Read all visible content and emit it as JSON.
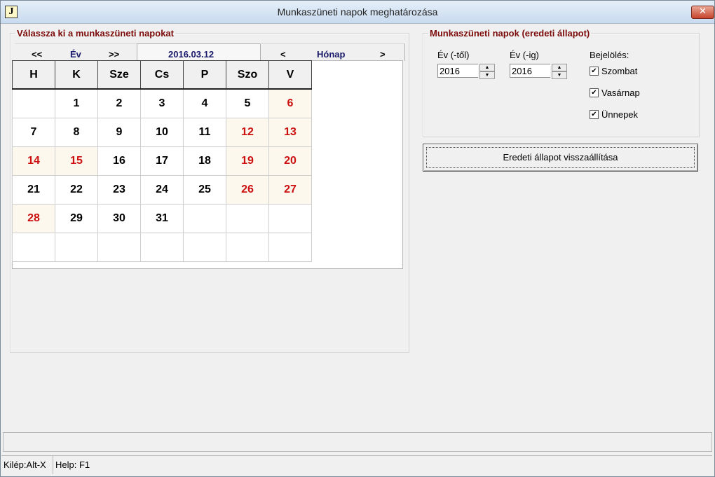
{
  "window": {
    "title": "Munkaszüneti napok meghatározása",
    "icon_letter": "J",
    "close_glyph": "✕"
  },
  "calendar_panel": {
    "legend": "Válassza ki a munkaszüneti napokat",
    "year_nav": {
      "prev": "<<",
      "label": "Év",
      "next": ">>"
    },
    "current_date": "2016.03.12",
    "month_nav": {
      "prev": "<",
      "label": "Hónap",
      "next": ">"
    },
    "weekdays": [
      "H",
      "K",
      "Sze",
      "Cs",
      "P",
      "Szo",
      "V"
    ],
    "weeks": [
      [
        {
          "d": ""
        },
        {
          "d": "1"
        },
        {
          "d": "2"
        },
        {
          "d": "3"
        },
        {
          "d": "4"
        },
        {
          "d": "5"
        },
        {
          "d": "6",
          "hol": true
        }
      ],
      [
        {
          "d": "7"
        },
        {
          "d": "8"
        },
        {
          "d": "9"
        },
        {
          "d": "10"
        },
        {
          "d": "11"
        },
        {
          "d": "12",
          "hol": true
        },
        {
          "d": "13",
          "hol": true
        }
      ],
      [
        {
          "d": "14",
          "hol": true
        },
        {
          "d": "15",
          "hol": true
        },
        {
          "d": "16"
        },
        {
          "d": "17"
        },
        {
          "d": "18"
        },
        {
          "d": "19",
          "hol": true
        },
        {
          "d": "20",
          "hol": true
        }
      ],
      [
        {
          "d": "21"
        },
        {
          "d": "22"
        },
        {
          "d": "23"
        },
        {
          "d": "24"
        },
        {
          "d": "25"
        },
        {
          "d": "26",
          "hol": true
        },
        {
          "d": "27",
          "hol": true
        }
      ],
      [
        {
          "d": "28",
          "hol": true
        },
        {
          "d": "29"
        },
        {
          "d": "30"
        },
        {
          "d": "31"
        },
        {
          "d": ""
        },
        {
          "d": ""
        },
        {
          "d": ""
        }
      ],
      [
        {
          "d": ""
        },
        {
          "d": ""
        },
        {
          "d": ""
        },
        {
          "d": ""
        },
        {
          "d": ""
        },
        {
          "d": ""
        },
        {
          "d": ""
        }
      ]
    ],
    "holiday_color": "#cc1010"
  },
  "original_panel": {
    "legend": "Munkaszüneti napok (eredeti állapot)",
    "year_from": {
      "label": "Év (-től)",
      "value": "2016"
    },
    "year_to": {
      "label": "Év (-ig)",
      "value": "2016"
    },
    "marking": {
      "label": "Bejelölés:",
      "options": [
        {
          "label": "Szombat",
          "checked": true
        },
        {
          "label": "Vasárnap",
          "checked": true
        },
        {
          "label": "Ünnepek",
          "checked": true
        }
      ]
    }
  },
  "restore_button": {
    "label": "Eredeti állapot visszaállítása"
  },
  "status": {
    "exit": "Kilép:Alt-X",
    "help": "Help: F1"
  }
}
